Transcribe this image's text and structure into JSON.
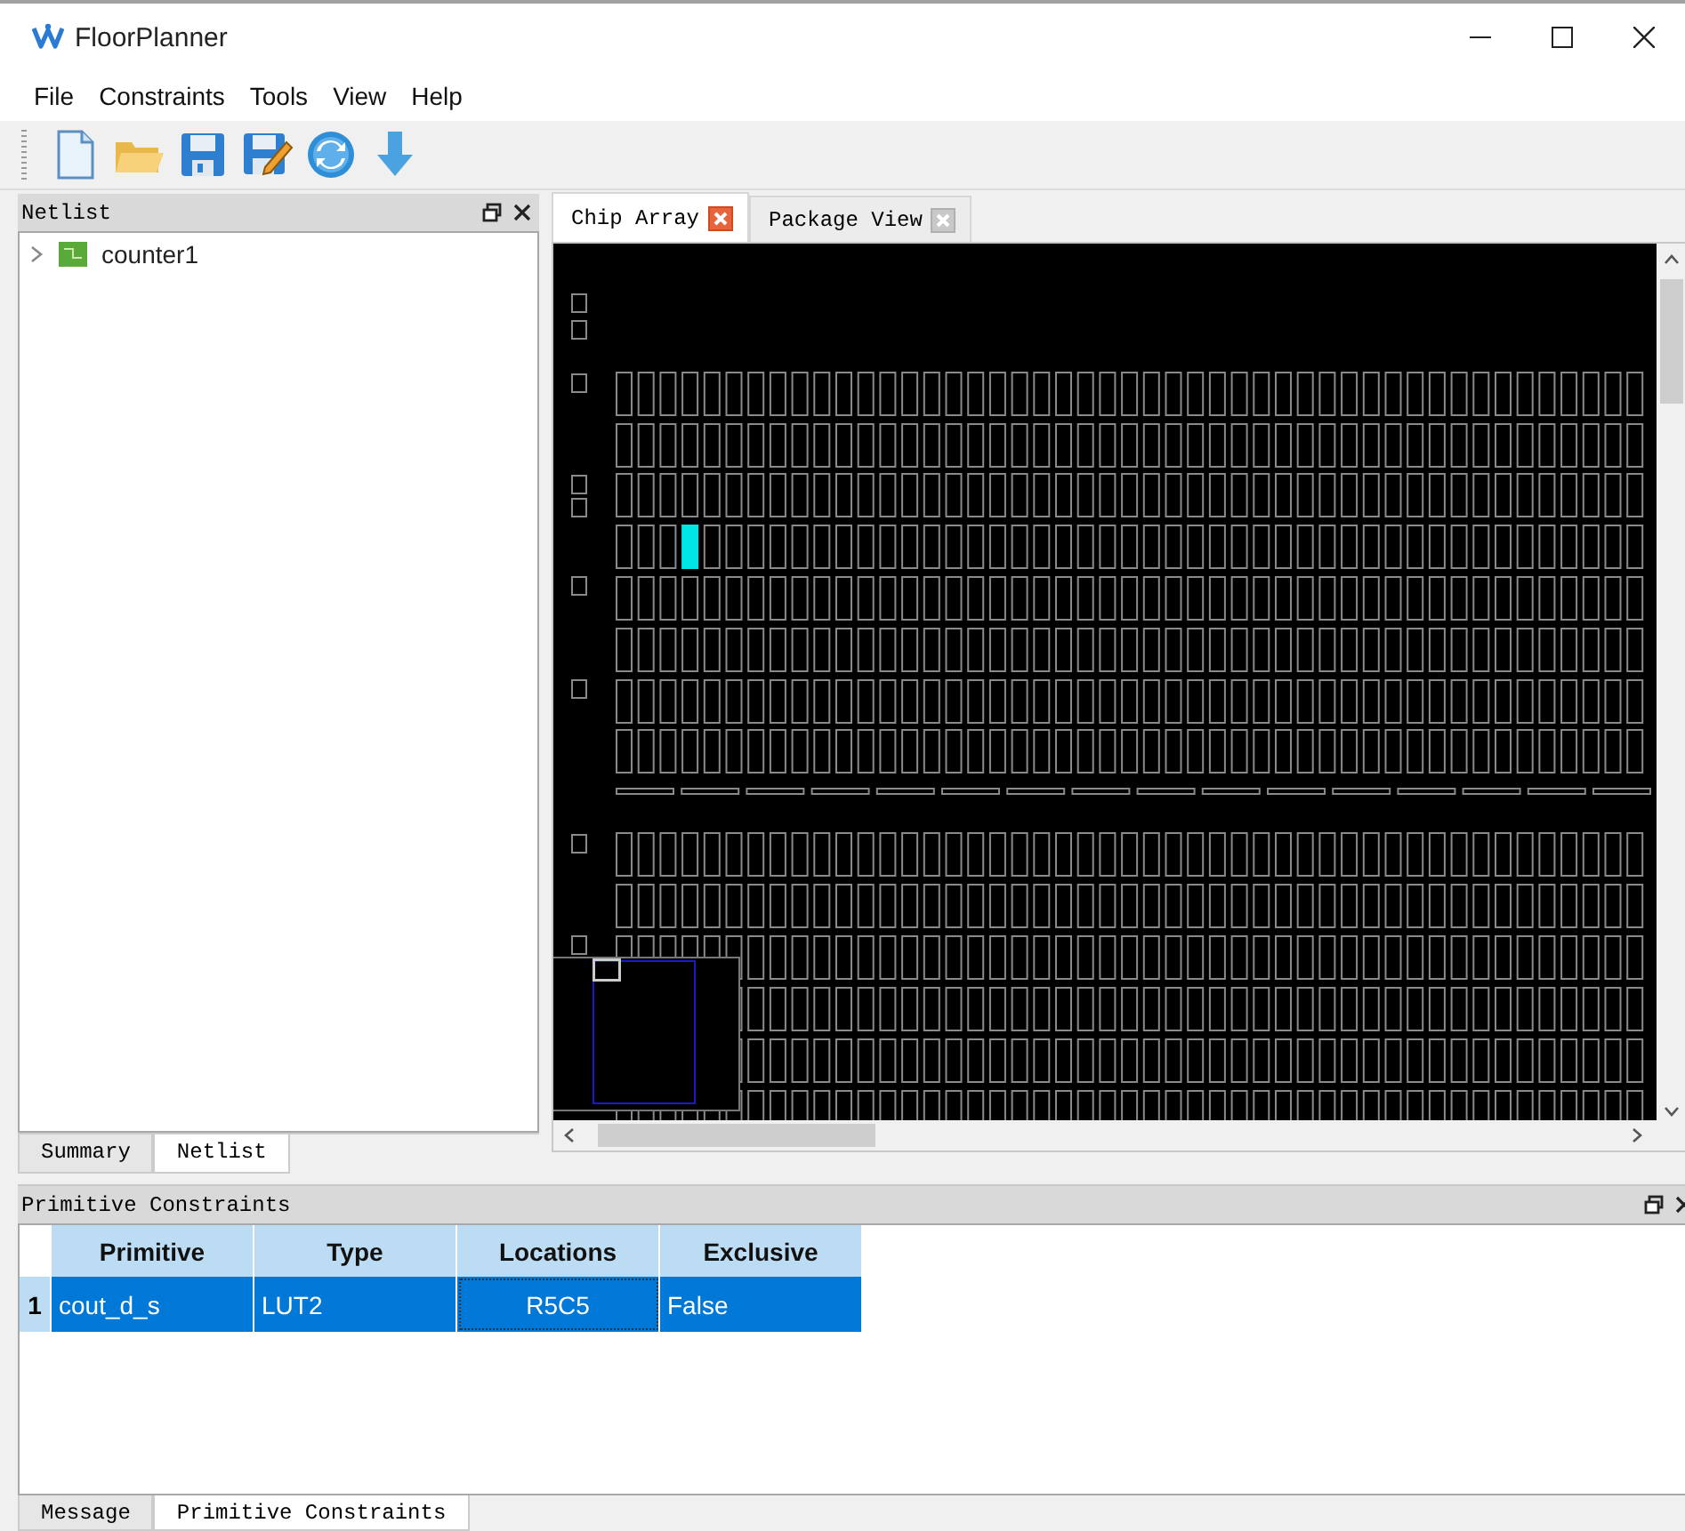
{
  "window": {
    "title": "FloorPlanner"
  },
  "menu": [
    "File",
    "Constraints",
    "Tools",
    "View",
    "Help"
  ],
  "netlist": {
    "title": "Netlist",
    "tree": [
      {
        "label": "counter1",
        "expanded": false
      }
    ],
    "tabs": [
      {
        "label": "Summary",
        "selected": false
      },
      {
        "label": "Netlist",
        "selected": true
      }
    ]
  },
  "editor_tabs": [
    {
      "label": "Chip Array",
      "selected": true
    },
    {
      "label": "Package View",
      "selected": false
    }
  ],
  "constraints": {
    "title": "Primitive Constraints",
    "columns": [
      "Primitive",
      "Type",
      "Locations",
      "Exclusive"
    ],
    "rows": [
      {
        "index": "1",
        "cells": [
          "cout_d_s",
          "LUT2",
          "R5C5",
          "False"
        ],
        "selected": true
      }
    ]
  },
  "bottom_tabs": [
    {
      "label": "Message",
      "selected": false
    },
    {
      "label": "Primitive Constraints",
      "selected": true
    }
  ]
}
